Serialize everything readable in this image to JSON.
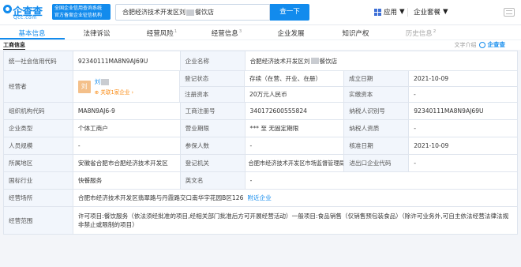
{
  "header": {
    "logo_text": "企查查",
    "logo_domain": "Qcc.com",
    "slogan_line1": "全国企业信用查询系统",
    "slogan_line2": "官方备案企业征信机构",
    "search_value": "合肥经济技术开发区刘",
    "search_value_suffix": "餐饮店",
    "search_button": "查一下",
    "apps_label": "应用",
    "vip_label": "企业套餐"
  },
  "tabs": [
    {
      "label": "基本信息",
      "count": "",
      "state": "active"
    },
    {
      "label": "法律诉讼",
      "count": "",
      "state": "normal"
    },
    {
      "label": "经营风险",
      "count": "1",
      "state": "normal"
    },
    {
      "label": "经营信息",
      "count": "3",
      "state": "normal"
    },
    {
      "label": "企业发展",
      "count": "",
      "state": "normal"
    },
    {
      "label": "知识产权",
      "count": "",
      "state": "normal"
    },
    {
      "label": "历史信息",
      "count": "2",
      "state": "faded"
    }
  ],
  "section": {
    "title": "工商信息",
    "right_text": "文字介绍",
    "right_logo": "企查查"
  },
  "info": {
    "credit_code_label": "统一社会信用代码",
    "credit_code": "92340111MA8N9AJ69U",
    "company_name_label": "企业名称",
    "company_name_prefix": "合肥经济技术开发区刘",
    "company_name_suffix": "餐饮店",
    "operator_label": "经营者",
    "operator_avatar": "刘",
    "operator_name": "刘",
    "operator_link": "关联1家企业",
    "status_label": "登记状态",
    "status": "存续（在营、开业、在册）",
    "established_label": "成立日期",
    "established": "2021-10-09",
    "capital_label": "注册资本",
    "capital": "20万元人民币",
    "paid_capital_label": "实缴资本",
    "paid_capital": "-",
    "org_code_label": "组织机构代码",
    "org_code": "MA8N9AJ6-9",
    "reg_no_label": "工商注册号",
    "reg_no": "340172600555824",
    "taxpayer_id_label": "纳税人识别号",
    "taxpayer_id": "92340111MA8N9AJ69U",
    "type_label": "企业类型",
    "type": "个体工商户",
    "term_label": "营业期限",
    "term": "*** 至 无固定期限",
    "taxpayer_qual_label": "纳税人资质",
    "taxpayer_qual": "-",
    "staff_label": "人员规模",
    "staff": "-",
    "insured_label": "参保人数",
    "insured": "-",
    "approval_label": "核准日期",
    "approval": "2021-10-09",
    "region_label": "所属地区",
    "region": "安徽省合肥市合肥经济技术开发区",
    "authority_label": "登记机关",
    "authority": "合肥市经济技术开发区市场监督管理局",
    "import_export_label": "进出口企业代码",
    "import_export": "-",
    "industry_label": "国标行业",
    "industry": "快餐服务",
    "english_name_label": "英文名",
    "english_name": "-",
    "address_label": "经营场所",
    "address": "合肥市经济技术开发区翡翠路与丹霞路交口南华宇花园B区126",
    "address_link": "附近企业",
    "scope_label": "经营范围",
    "scope": "许可项目:餐饮服务（依法须经批准的项目,经相关部门批准后方可开展经营活动）一般项目:食品销售（仅销售预包装食品）（除许可业务外,可自主依法经营法律法规非禁止或限制的项目）"
  },
  "colors": {
    "brand": "#128bed",
    "label_bg": "#f2f6fc",
    "link_orange": "#fa8c16"
  }
}
